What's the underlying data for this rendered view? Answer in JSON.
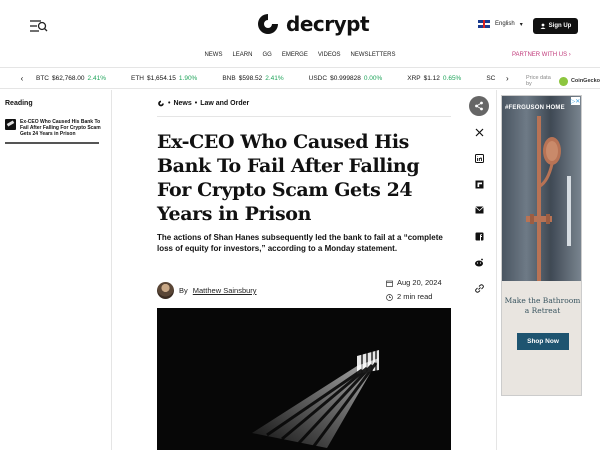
{
  "header": {
    "logo_text": "decrypt",
    "language": "English",
    "signup_label": "Sign Up",
    "nav": [
      "NEWS",
      "LEARN",
      "GG",
      "EMERGE",
      "VIDEOS",
      "NEWSLETTERS"
    ],
    "partner_label": "PARTNER WITH US"
  },
  "ticker": {
    "coins": [
      {
        "symbol": "BTC",
        "price": "$62,768.00",
        "change": "2.41%"
      },
      {
        "symbol": "ETH",
        "price": "$1,654.15",
        "change": "1.90%"
      },
      {
        "symbol": "BNB",
        "price": "$598.52",
        "change": "2.41%"
      },
      {
        "symbol": "USDC",
        "price": "$0.999828",
        "change": "0.00%"
      },
      {
        "symbol": "XRP",
        "price": "$1.12",
        "change": "0.65%"
      },
      {
        "symbol": "SC",
        "price": "",
        "change": ""
      }
    ],
    "price_data_label": "Price data by",
    "provider": "CoinGecko"
  },
  "reading": {
    "title": "Reading",
    "item": "Ex-CEO Who Caused His Bank To Fail After Falling For Crypto Scam Gets 24 Years in Prison"
  },
  "article": {
    "breadcrumb": [
      "News",
      "Law and Order"
    ],
    "title": "Ex-CEO Who Caused His Bank To Fail After Falling For Crypto Scam Gets 24 Years in Prison",
    "dek": "The actions of Shan Hanes subsequently led the bank to fail at a “complete loss of equity for investors,” according to a Monday statement.",
    "by_label": "By",
    "author": "Matthew Sainsbury",
    "date": "Aug 20, 2024",
    "read_time": "2 min read"
  },
  "share": [
    "share-icon",
    "x-icon",
    "linkedin-icon",
    "flipboard-icon",
    "email-icon",
    "facebook-icon",
    "reddit-icon",
    "link-icon"
  ],
  "ad": {
    "brand": "#FERGUSON HOME",
    "tagline": "Make the Bathroom a Retreat",
    "cta": "Shop Now"
  }
}
